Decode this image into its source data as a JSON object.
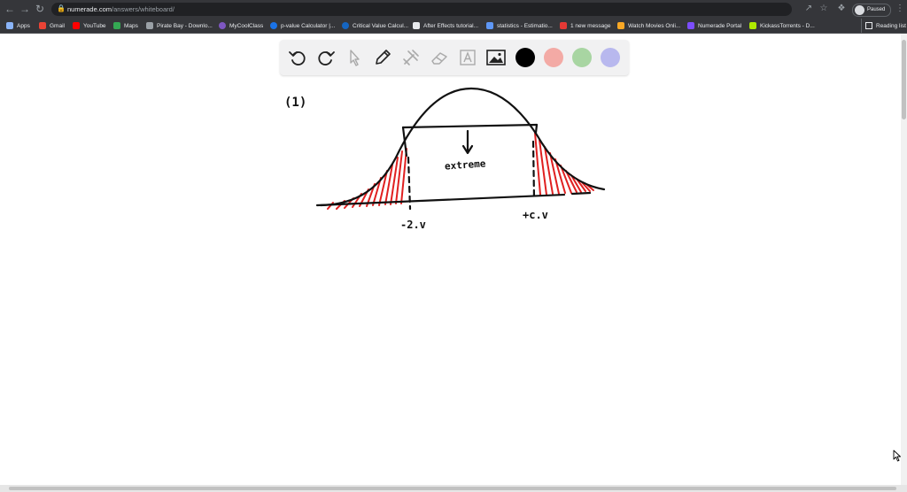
{
  "browser": {
    "url_host": "numerade.com",
    "url_path": "/answers/whiteboard/",
    "profile_label": "Paused",
    "bookmarks": [
      {
        "label": "Apps",
        "color": "#8ab4f8"
      },
      {
        "label": "Gmail",
        "color": "#ea4335"
      },
      {
        "label": "YouTube",
        "color": "#ff0000"
      },
      {
        "label": "Maps",
        "color": "#34a853"
      },
      {
        "label": "Pirate Bay - Downlo...",
        "color": "#9aa0a6"
      },
      {
        "label": "MyCoolClass",
        "color": "#7e57c2"
      },
      {
        "label": "p-value Calculator |...",
        "color": "#1a73e8"
      },
      {
        "label": "Critical Value Calcul...",
        "color": "#1565c0"
      },
      {
        "label": "After Effects tutorial...",
        "color": "#e8eaed"
      },
      {
        "label": "statistics - Estimatio...",
        "color": "#5e97f6"
      },
      {
        "label": "1 new message",
        "color": "#e53935"
      },
      {
        "label": "Watch Movies Onli...",
        "color": "#f9a825"
      },
      {
        "label": "Numerade Portal",
        "color": "#7c4dff"
      },
      {
        "label": "KickassTorrents - D...",
        "color": "#aeea00"
      }
    ],
    "reading_list": "Reading list"
  },
  "whiteboard": {
    "tools": [
      {
        "name": "undo-icon"
      },
      {
        "name": "redo-icon"
      },
      {
        "name": "select-cursor-icon"
      },
      {
        "name": "pencil-icon"
      },
      {
        "name": "tools-icon"
      },
      {
        "name": "eraser-icon"
      },
      {
        "name": "text-icon"
      },
      {
        "name": "image-icon"
      }
    ],
    "colors": [
      "#000000",
      "#f3aaa5",
      "#a8d5a2",
      "#b8b8ee"
    ],
    "accent_red": "#e02020",
    "annotations": {
      "question_number": "(1)",
      "middle_label": "extreme",
      "left_value": "-2.v",
      "right_value": "+c.v"
    }
  }
}
